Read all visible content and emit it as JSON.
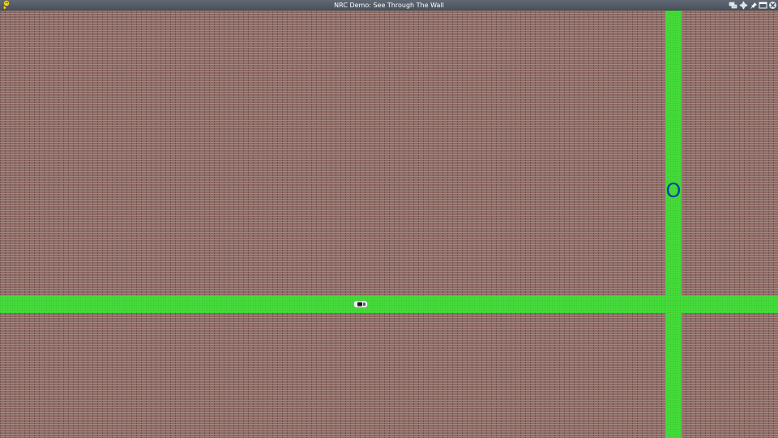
{
  "window": {
    "title": "NRC Demo: See Through The Wall",
    "app_icon": "pygame-snake-icon",
    "controls": [
      "restore-icon",
      "move-icon",
      "pin-icon",
      "maximize-icon",
      "close-icon"
    ]
  },
  "scene": {
    "wall": "brick-wall",
    "road_color": "#45dd3a",
    "wall_color": "#8e6a64",
    "target_label": "O",
    "target_color": "#0c3ea8",
    "car": "white-car"
  }
}
